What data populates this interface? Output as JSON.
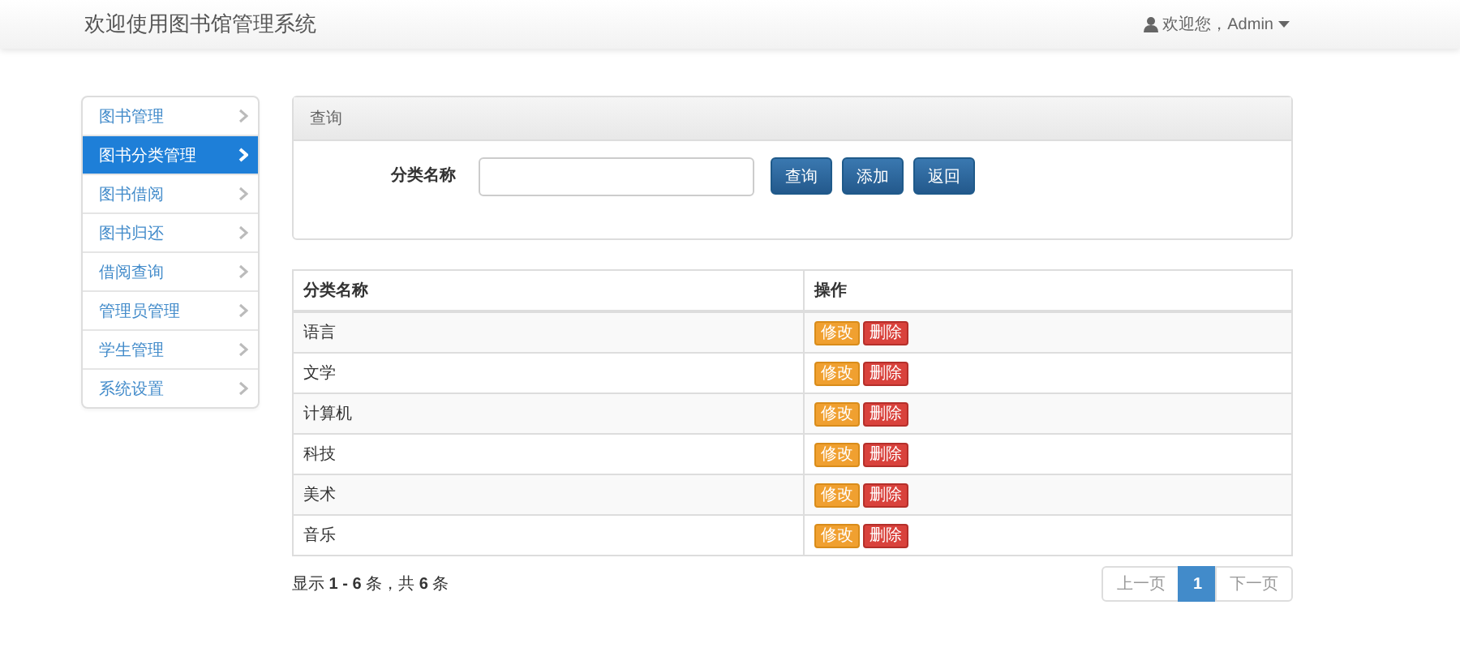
{
  "navbar": {
    "title": "欢迎使用图书馆管理系统",
    "user_menu": "欢迎您，Admin"
  },
  "sidebar": {
    "items": [
      {
        "label": "图书管理",
        "selected": false
      },
      {
        "label": "图书分类管理",
        "selected": true
      },
      {
        "label": "图书借阅",
        "selected": false
      },
      {
        "label": "图书归还",
        "selected": false
      },
      {
        "label": "借阅查询",
        "selected": false
      },
      {
        "label": "管理员管理",
        "selected": false
      },
      {
        "label": "学生管理",
        "selected": false
      },
      {
        "label": "系统设置",
        "selected": false
      }
    ]
  },
  "search_panel": {
    "title": "查询",
    "field_label": "分类名称",
    "buttons": [
      "查询",
      "添加",
      "返回"
    ]
  },
  "table": {
    "columns": [
      "分类名称",
      "操作"
    ],
    "rows": [
      {
        "name": "语言",
        "actions": [
          "修改",
          "删除"
        ]
      },
      {
        "name": "文学",
        "actions": [
          "修改",
          "删除"
        ]
      },
      {
        "name": "计算机",
        "actions": [
          "修改",
          "删除"
        ]
      },
      {
        "name": "科技",
        "actions": [
          "修改",
          "删除"
        ]
      },
      {
        "name": "美术",
        "actions": [
          "修改",
          "删除"
        ]
      },
      {
        "name": "音乐",
        "actions": [
          "修改",
          "删除"
        ]
      }
    ]
  },
  "footer": {
    "summary": "显示 **1 - 6** 条，共 **6** 条",
    "pagination": [
      {
        "label": "上一页",
        "selected": false
      },
      {
        "label": "1",
        "selected": true
      },
      {
        "label": "下一页",
        "selected": false
      }
    ]
  }
}
